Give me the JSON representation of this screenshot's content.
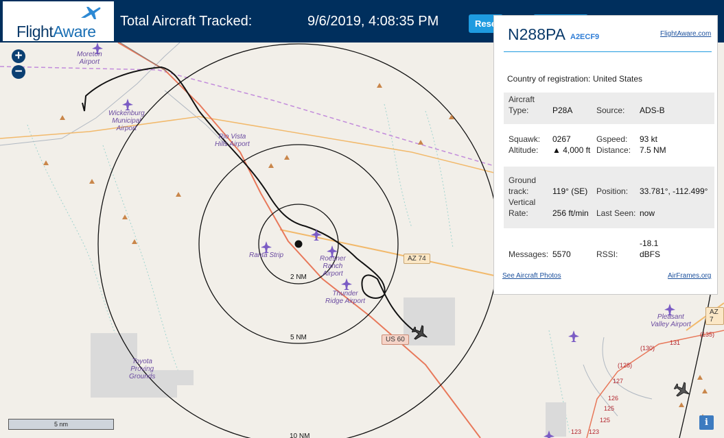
{
  "header": {
    "logo_flight": "Flight",
    "logo_aware": "Aware",
    "title": "Total Aircraft Tracked:",
    "datetime": "9/6/2019, 4:08:35 PM",
    "reset_label": "Reset"
  },
  "map": {
    "zoom_in": "+",
    "zoom_out": "−",
    "scale_label": "5 nm",
    "info_label": "i",
    "airports": [
      "Moreton Airport",
      "Wickenburg Municipal Airport",
      "Rio Vista Hills Airport",
      "Ranta Strip",
      "Roesner Ranch Airport",
      "Thunder Ridge Airport",
      "Toyota Proving Grounds",
      "Pleasant Valley Airport"
    ],
    "labels": {
      "moreton": [
        "Moreton",
        "Airport"
      ],
      "wickenburg": [
        "Wickenburg",
        "Municipal",
        "Airport"
      ],
      "riovista": [
        "Rio Vista",
        "Hills Airport"
      ],
      "ranta": [
        "Ranta Strip"
      ],
      "roesner": [
        "Roesner",
        "Ranch",
        "Airport"
      ],
      "thunder": [
        "Thunder",
        "Ridge Airport"
      ],
      "toyota": [
        "Toyota",
        "Proving",
        "Grounds"
      ],
      "pleasant": [
        "Pleasant",
        "Valley Airport"
      ]
    },
    "road_signs": {
      "az74": "AZ 74",
      "us60": "US 60",
      "az7": "AZ 7"
    },
    "range_rings": {
      "r2": "2 NM",
      "r5": "5 NM",
      "r10": "10 NM"
    },
    "route_numbers": [
      "(135)",
      "131",
      "(130)",
      "(128)",
      "127",
      "126",
      "125",
      "125",
      "123",
      "123"
    ]
  },
  "panel": {
    "ident": "N288PA",
    "hex": "A2ECF9",
    "fa_link": "FlightAware.com",
    "country_label": "Country of registration:",
    "country_value": "United States",
    "aircraft_type_label_1": "Aircraft",
    "aircraft_type_label_2": "Type:",
    "aircraft_type": "P28A",
    "source_label": "Source:",
    "source": "ADS-B",
    "squawk_label": "Squawk:",
    "squawk": "0267",
    "altitude_label": "Altitude:",
    "altitude": "▲ 4,000 ft",
    "gspeed_label": "Gspeed:",
    "gspeed": "93 kt",
    "distance_label": "Distance:",
    "distance": "7.5 NM",
    "ground_label_1": "Ground",
    "ground_label_2": "track:",
    "ground_track": "119° (SE)",
    "vertical_label_1": "Vertical",
    "vertical_label_2": "Rate:",
    "vertical_rate": "256 ft/min",
    "position_label": "Position:",
    "position": "33.781°, -112.499°",
    "lastseen_label": "Last Seen:",
    "last_seen": "now",
    "messages_label": "Messages:",
    "messages": "5570",
    "rssi_label": "RSSI:",
    "rssi_value": "-18.1",
    "rssi_unit": "dBFS",
    "photos_link": "See Aircraft Photos",
    "airframes_link": "AirFrames.org"
  },
  "colors": {
    "header_bg": "#002f5d",
    "accent": "#1e9be0",
    "map_bg": "#f2efe9",
    "route": "#e8785a",
    "az74_road": "#f2b96b",
    "airport_icon": "#7b5cc4"
  }
}
